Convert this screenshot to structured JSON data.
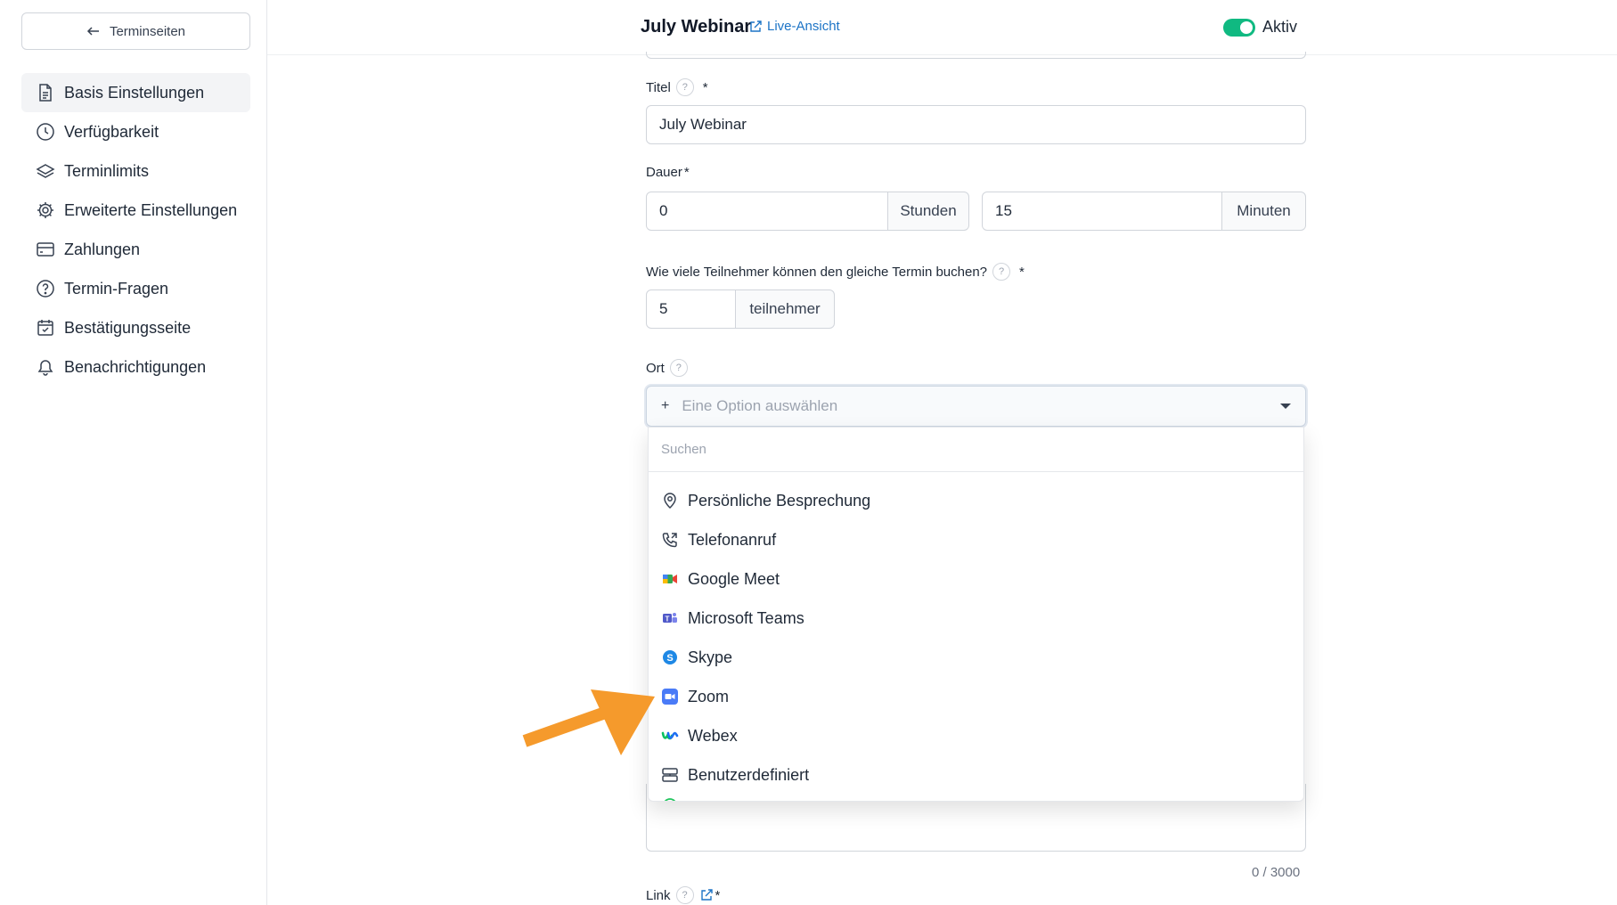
{
  "sidebar": {
    "back_label": "Terminseiten",
    "items": [
      {
        "label": "Basis Einstellungen",
        "icon": "document-icon",
        "active": true
      },
      {
        "label": "Verfügbarkeit",
        "icon": "clock-icon"
      },
      {
        "label": "Terminlimits",
        "icon": "layers-icon"
      },
      {
        "label": "Erweiterte Einstellungen",
        "icon": "gear-icon"
      },
      {
        "label": "Zahlungen",
        "icon": "credit-card-icon"
      },
      {
        "label": "Termin-Fragen",
        "icon": "question-circle-icon"
      },
      {
        "label": "Bestätigungsseite",
        "icon": "calendar-check-icon"
      },
      {
        "label": "Benachrichtigungen",
        "icon": "bell-icon"
      }
    ]
  },
  "header": {
    "title": "July Webinar",
    "live_link": "Live-Ansicht",
    "toggle_label": "Aktiv",
    "toggle_on": true
  },
  "form": {
    "title_label": "Titel",
    "title_value": "July Webinar",
    "duration_label": "Dauer",
    "hours_value": "0",
    "hours_unit": "Stunden",
    "minutes_value": "15",
    "minutes_unit": "Minuten",
    "attendees_label": "Wie viele Teilnehmer können den gleiche Termin buchen?",
    "attendees_value": "5",
    "attendees_unit": "teilnehmer",
    "location_label": "Ort",
    "location_placeholder": "Eine Option auswählen",
    "location_plus": "+",
    "search_placeholder": "Suchen",
    "location_options": [
      {
        "label": "Persönliche Besprechung",
        "icon": "map-pin-icon"
      },
      {
        "label": "Telefonanruf",
        "icon": "phone-icon"
      },
      {
        "label": "Google Meet",
        "icon": "google-meet-icon"
      },
      {
        "label": "Microsoft Teams",
        "icon": "microsoft-teams-icon"
      },
      {
        "label": "Skype",
        "icon": "skype-icon"
      },
      {
        "label": "Zoom",
        "icon": "zoom-icon"
      },
      {
        "label": "Webex",
        "icon": "webex-icon"
      },
      {
        "label": "Benutzerdefiniert",
        "icon": "custom-layout-icon"
      }
    ],
    "char_counter": "0 / 3000",
    "link_label": "Link",
    "required_mark": "*",
    "help_mark": "?"
  },
  "colors": {
    "toggle_on": "#10b981",
    "link": "#1d74c6",
    "annotation_arrow": "#f59a2c"
  }
}
